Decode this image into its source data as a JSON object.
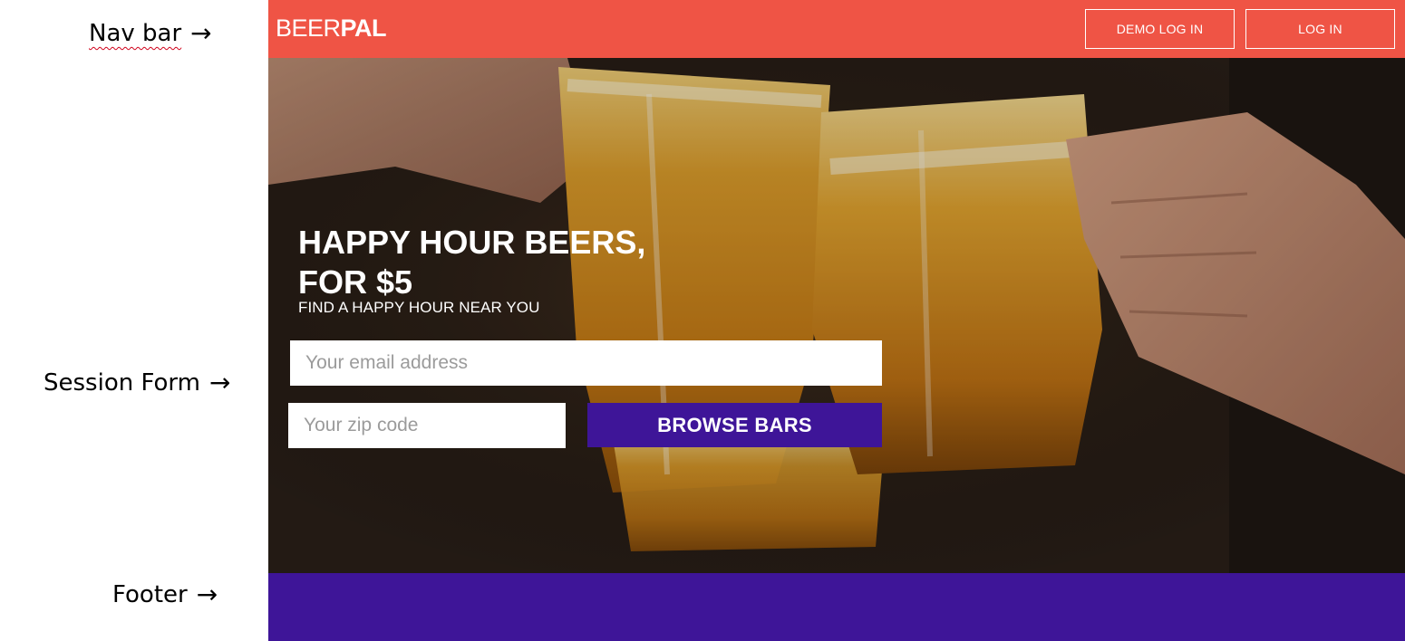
{
  "annotations": {
    "nav_bar": {
      "label": "Nav bar",
      "arrow": "→"
    },
    "session_form": {
      "label": "Session Form",
      "arrow": "→"
    },
    "footer": {
      "label": "Footer",
      "arrow": "→"
    }
  },
  "navbar": {
    "logo_part1": "BEER",
    "logo_part2": "PAL",
    "demo_login_label": "DEMO LOG IN",
    "login_label": "LOG IN",
    "background_color": "#ef5445"
  },
  "hero": {
    "headline_line1": "HAPPY HOUR BEERS,",
    "headline_line2": "FOR $5",
    "subheadline": "FIND A HAPPY HOUR NEAR YOU"
  },
  "session_form": {
    "email_placeholder": "Your email address",
    "zip_placeholder": "Your zip code",
    "submit_label": "BROWSE BARS",
    "button_color": "#3e1598"
  },
  "footer": {
    "background_color": "#3e1598"
  }
}
